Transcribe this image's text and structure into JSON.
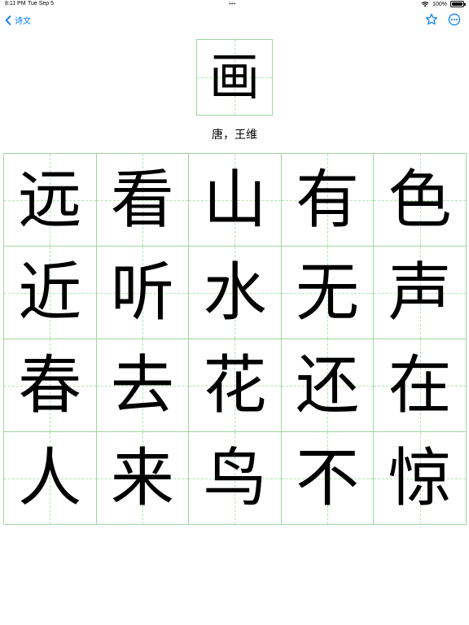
{
  "status_bar": {
    "time": "8:11 PM",
    "date": "Tue Sep 5",
    "battery": "100%"
  },
  "nav": {
    "back_label": "诗文",
    "back_icon": "chevron-left-icon",
    "favorite_icon": "star-icon",
    "more_icon": "ellipsis-circle-icon",
    "accent_color": "#007aff"
  },
  "poem": {
    "title": "画",
    "author": "唐，王维",
    "lines": [
      [
        "远",
        "看",
        "山",
        "有",
        "色"
      ],
      [
        "近",
        "听",
        "水",
        "无",
        "声"
      ],
      [
        "春",
        "去",
        "花",
        "还",
        "在"
      ],
      [
        "人",
        "来",
        "鸟",
        "不",
        "惊"
      ]
    ]
  },
  "grid_color": "#9fd69f"
}
